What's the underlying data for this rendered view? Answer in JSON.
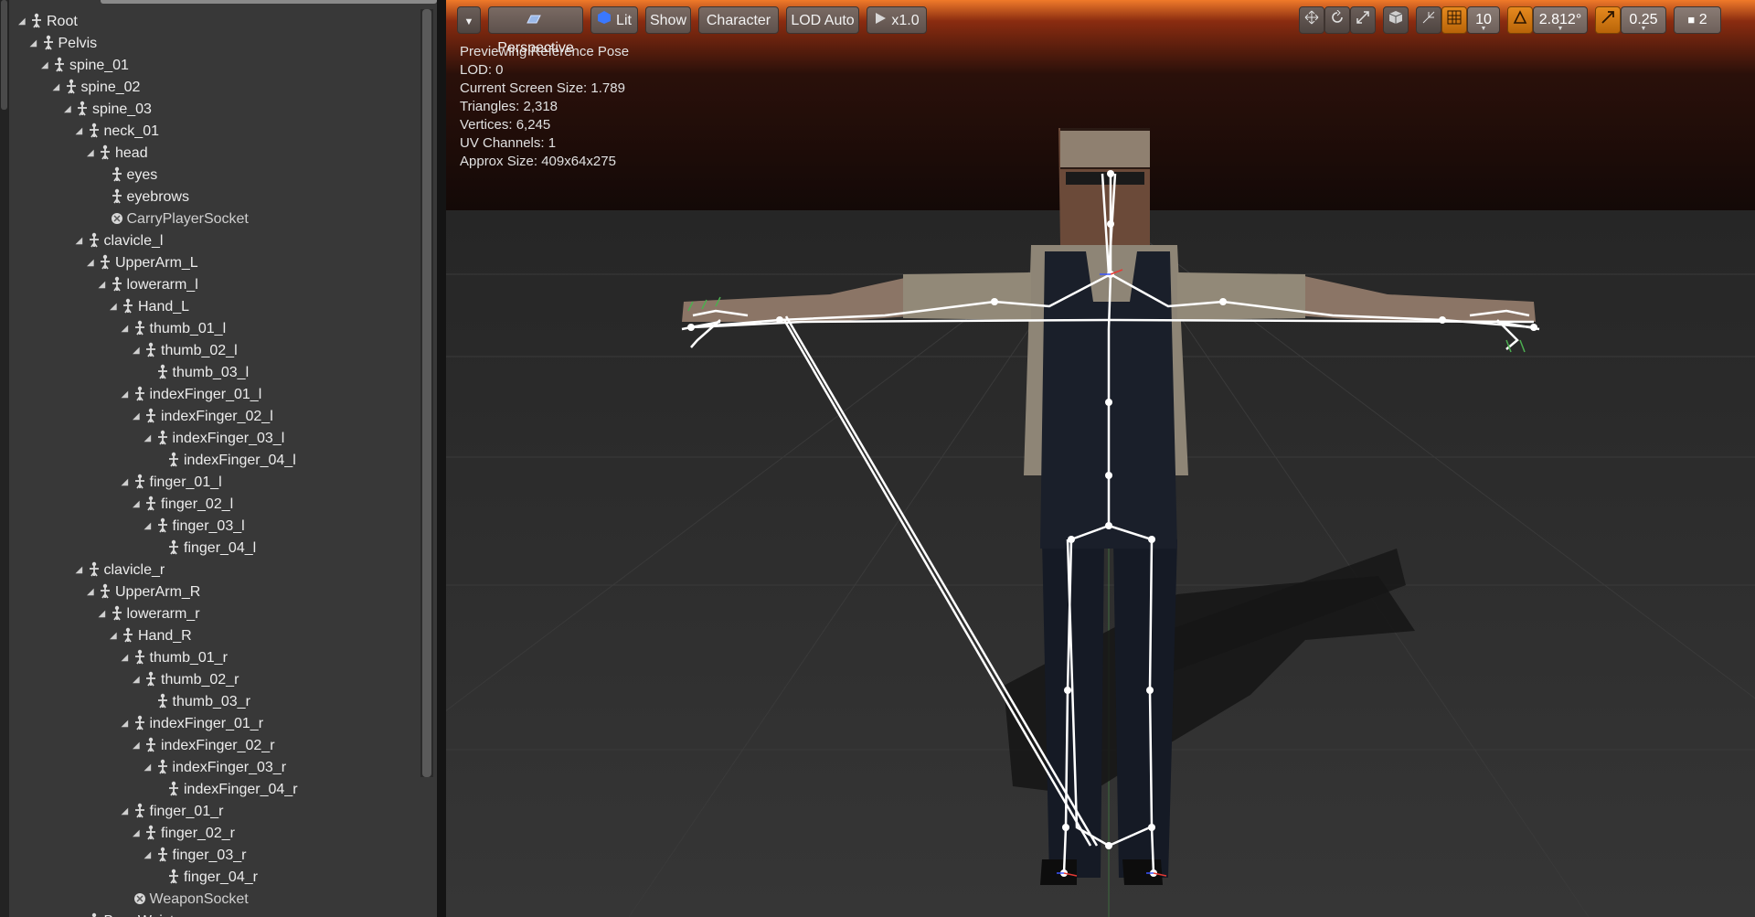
{
  "tree": {
    "rows": [
      {
        "label": "Root",
        "depth": 0,
        "arrow": true,
        "type": "bone"
      },
      {
        "label": "Pelvis",
        "depth": 1,
        "arrow": true,
        "type": "bone"
      },
      {
        "label": "spine_01",
        "depth": 2,
        "arrow": true,
        "type": "bone"
      },
      {
        "label": "spine_02",
        "depth": 3,
        "arrow": true,
        "type": "bone"
      },
      {
        "label": "spine_03",
        "depth": 4,
        "arrow": true,
        "type": "bone"
      },
      {
        "label": "neck_01",
        "depth": 5,
        "arrow": true,
        "type": "bone"
      },
      {
        "label": "head",
        "depth": 6,
        "arrow": true,
        "type": "bone"
      },
      {
        "label": "eyes",
        "depth": 7,
        "arrow": false,
        "type": "bone"
      },
      {
        "label": "eyebrows",
        "depth": 7,
        "arrow": false,
        "type": "bone"
      },
      {
        "label": "CarryPlayerSocket",
        "depth": 7,
        "arrow": false,
        "type": "socket"
      },
      {
        "label": "clavicle_l",
        "depth": 5,
        "arrow": true,
        "type": "bone"
      },
      {
        "label": "UpperArm_L",
        "depth": 6,
        "arrow": true,
        "type": "bone"
      },
      {
        "label": "lowerarm_l",
        "depth": 7,
        "arrow": true,
        "type": "bone"
      },
      {
        "label": "Hand_L",
        "depth": 8,
        "arrow": true,
        "type": "bone"
      },
      {
        "label": "thumb_01_l",
        "depth": 9,
        "arrow": true,
        "type": "bone"
      },
      {
        "label": "thumb_02_l",
        "depth": 10,
        "arrow": true,
        "type": "bone"
      },
      {
        "label": "thumb_03_l",
        "depth": 11,
        "arrow": false,
        "type": "bone"
      },
      {
        "label": "indexFinger_01_l",
        "depth": 9,
        "arrow": true,
        "type": "bone"
      },
      {
        "label": "indexFinger_02_l",
        "depth": 10,
        "arrow": true,
        "type": "bone"
      },
      {
        "label": "indexFinger_03_l",
        "depth": 11,
        "arrow": true,
        "type": "bone"
      },
      {
        "label": "indexFinger_04_l",
        "depth": 12,
        "arrow": false,
        "type": "bone"
      },
      {
        "label": "finger_01_l",
        "depth": 9,
        "arrow": true,
        "type": "bone"
      },
      {
        "label": "finger_02_l",
        "depth": 10,
        "arrow": true,
        "type": "bone"
      },
      {
        "label": "finger_03_l",
        "depth": 11,
        "arrow": true,
        "type": "bone"
      },
      {
        "label": "finger_04_l",
        "depth": 12,
        "arrow": false,
        "type": "bone"
      },
      {
        "label": "clavicle_r",
        "depth": 5,
        "arrow": true,
        "type": "bone"
      },
      {
        "label": "UpperArm_R",
        "depth": 6,
        "arrow": true,
        "type": "bone"
      },
      {
        "label": "lowerarm_r",
        "depth": 7,
        "arrow": true,
        "type": "bone"
      },
      {
        "label": "Hand_R",
        "depth": 8,
        "arrow": true,
        "type": "bone"
      },
      {
        "label": "thumb_01_r",
        "depth": 9,
        "arrow": true,
        "type": "bone"
      },
      {
        "label": "thumb_02_r",
        "depth": 10,
        "arrow": true,
        "type": "bone"
      },
      {
        "label": "thumb_03_r",
        "depth": 11,
        "arrow": false,
        "type": "bone"
      },
      {
        "label": "indexFinger_01_r",
        "depth": 9,
        "arrow": true,
        "type": "bone"
      },
      {
        "label": "indexFinger_02_r",
        "depth": 10,
        "arrow": true,
        "type": "bone"
      },
      {
        "label": "indexFinger_03_r",
        "depth": 11,
        "arrow": true,
        "type": "bone"
      },
      {
        "label": "indexFinger_04_r",
        "depth": 12,
        "arrow": false,
        "type": "bone"
      },
      {
        "label": "finger_01_r",
        "depth": 9,
        "arrow": true,
        "type": "bone"
      },
      {
        "label": "finger_02_r",
        "depth": 10,
        "arrow": true,
        "type": "bone"
      },
      {
        "label": "finger_03_r",
        "depth": 11,
        "arrow": true,
        "type": "bone"
      },
      {
        "label": "finger_04_r",
        "depth": 12,
        "arrow": false,
        "type": "bone"
      },
      {
        "label": "WeaponSocket",
        "depth": 9,
        "arrow": false,
        "type": "socket"
      },
      {
        "label": "BoneWaist",
        "depth": 5,
        "arrow": true,
        "type": "bone"
      }
    ]
  },
  "toolbar": {
    "perspective_label": "Perspective",
    "lit_label": "Lit",
    "show_label": "Show",
    "character_label": "Character",
    "lod_label": "LOD Auto",
    "speed_label": "x1.0",
    "grid_snap_value": "10",
    "rotation_snap_value": "2.812°",
    "scale_snap_value": "0.25",
    "camera_speed_value": "2"
  },
  "stats": {
    "line1": "Previewing Reference Pose",
    "line2": "LOD: 0",
    "line3": "Current Screen Size: 1.789",
    "line4": "Triangles: 2,318",
    "line5": "Vertices: 6,245",
    "line6": "UV Channels: 1",
    "line7": "Approx Size: 409x64x275"
  },
  "colors": {
    "accent_orange": "#e68a1f",
    "panel_bg": "#383838",
    "bone_wire": "#ffffff"
  }
}
